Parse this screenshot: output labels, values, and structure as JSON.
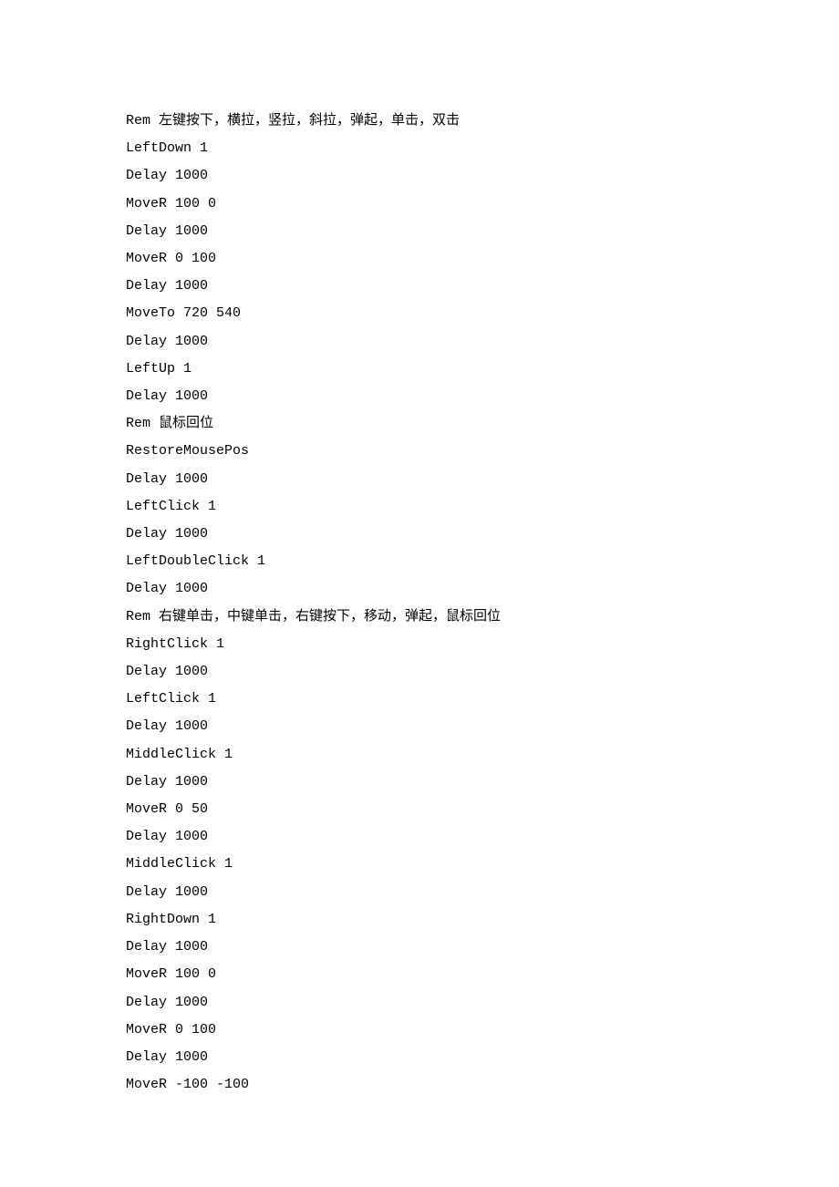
{
  "lines": [
    "Rem 左键按下，横拉，竖拉，斜拉，弹起，单击，双击",
    "LeftDown 1",
    "Delay 1000",
    "MoveR 100 0",
    "Delay 1000",
    "MoveR 0 100",
    "Delay 1000",
    "MoveTo 720 540",
    "Delay 1000",
    "LeftUp 1",
    "Delay 1000",
    "Rem 鼠标回位",
    "RestoreMousePos",
    "Delay 1000",
    "LeftClick 1",
    "Delay 1000",
    "LeftDoubleClick 1",
    "Delay 1000",
    "Rem 右键单击，中键单击，右键按下，移动，弹起，鼠标回位",
    "RightClick 1",
    "Delay 1000",
    "LeftClick 1",
    "Delay 1000",
    "MiddleClick 1",
    "Delay 1000",
    "MoveR 0 50",
    "Delay 1000",
    "MiddleClick 1",
    "Delay 1000",
    "RightDown 1",
    "Delay 1000",
    "MoveR 100 0",
    "Delay 1000",
    "MoveR 0 100",
    "Delay 1000",
    "MoveR -100 -100"
  ]
}
